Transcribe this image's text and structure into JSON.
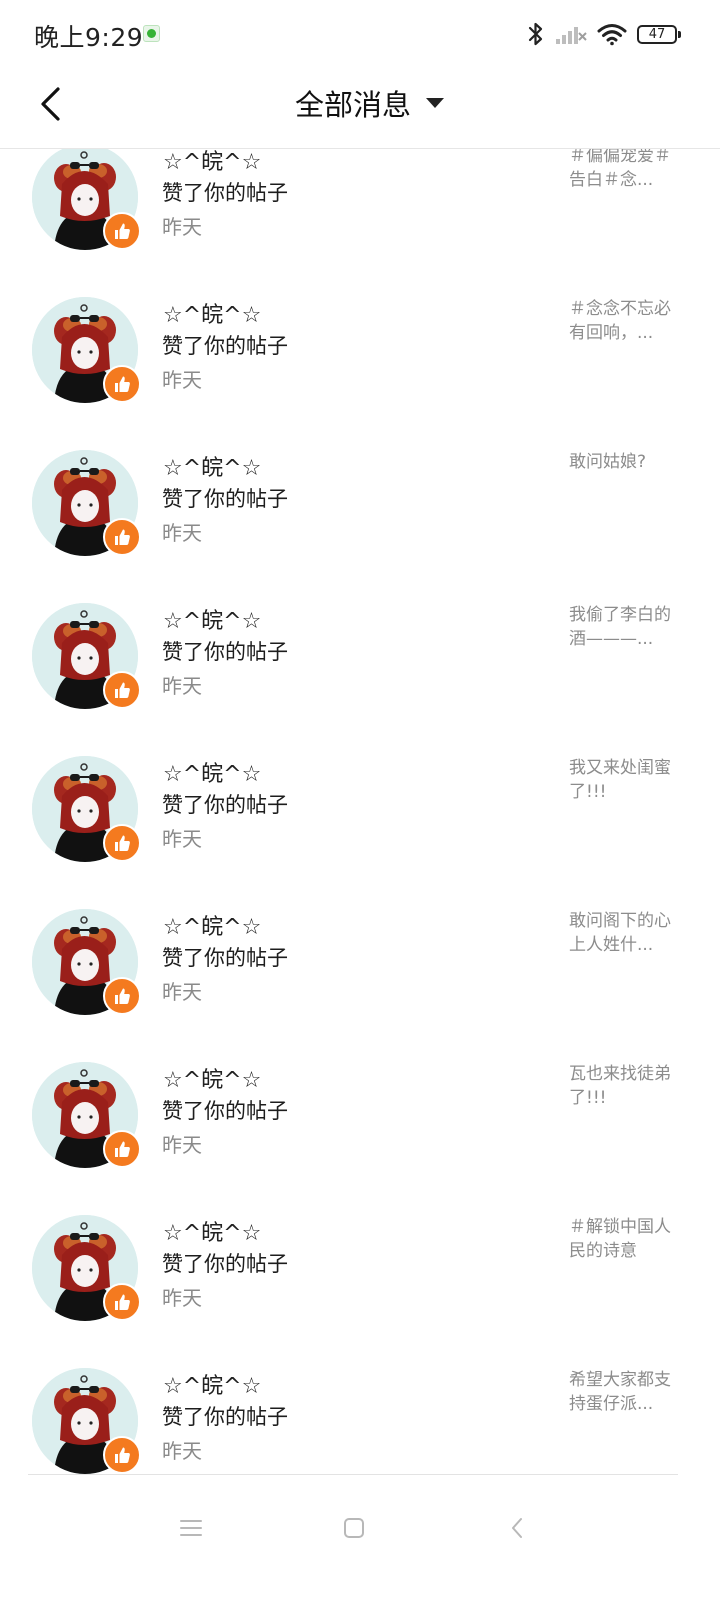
{
  "status_bar": {
    "time": "晚上9:29",
    "battery": "47",
    "app_icon": "wechat-icon",
    "icons": [
      "bluetooth-icon",
      "signal-icon",
      "wifi-icon",
      "battery-icon"
    ]
  },
  "header": {
    "title": "全部消息",
    "back_icon": "chevron-left-icon",
    "dropdown_icon": "caret-down-icon"
  },
  "notifications": [
    {
      "user": "☆^皖^☆",
      "action": "赞了你的帖子",
      "time": "昨天",
      "snippet": "＃偏偏宠爱＃告白＃念..."
    },
    {
      "user": "☆^皖^☆",
      "action": "赞了你的帖子",
      "time": "昨天",
      "snippet": "＃念念不忘必有回响，..."
    },
    {
      "user": "☆^皖^☆",
      "action": "赞了你的帖子",
      "time": "昨天",
      "snippet": "敢问姑娘?"
    },
    {
      "user": "☆^皖^☆",
      "action": "赞了你的帖子",
      "time": "昨天",
      "snippet": "我偷了李白的酒———..."
    },
    {
      "user": "☆^皖^☆",
      "action": "赞了你的帖子",
      "time": "昨天",
      "snippet": "我又来处闺蜜了!!!"
    },
    {
      "user": "☆^皖^☆",
      "action": "赞了你的帖子",
      "time": "昨天",
      "snippet": "敢问阁下的心上人姓什..."
    },
    {
      "user": "☆^皖^☆",
      "action": "赞了你的帖子",
      "time": "昨天",
      "snippet": "瓦也来找徒弟了!!!"
    },
    {
      "user": "☆^皖^☆",
      "action": "赞了你的帖子",
      "time": "昨天",
      "snippet": "＃解锁中国人民的诗意"
    },
    {
      "user": "☆^皖^☆",
      "action": "赞了你的帖子",
      "time": "昨天",
      "snippet": "希望大家都支持蛋仔派..."
    }
  ],
  "nav_bar": {
    "buttons": [
      "menu-icon",
      "home-icon",
      "back-icon"
    ]
  },
  "colors": {
    "accent": "#f47a1f",
    "secondary_text": "#8a8a8a",
    "avatar_bg": "#dbeeee"
  }
}
